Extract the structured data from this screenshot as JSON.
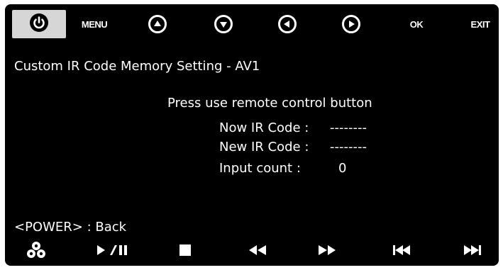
{
  "topbar": {
    "menu_label": "MENU",
    "ok_label": "OK",
    "exit_label": "EXIT"
  },
  "screen": {
    "title": "Custom IR Code Memory Setting - AV1",
    "instruction": "Press use remote control button",
    "now_ir_label": "Now IR Code :",
    "now_ir_value": "--------",
    "new_ir_label": "New IR Code :",
    "new_ir_value": "--------",
    "input_count_label": "Input count :",
    "input_count_value": "0",
    "footer_hint": "<POWER> : Back"
  },
  "icons": {
    "top": [
      "power-icon",
      "up-arrow-icon",
      "down-arrow-icon",
      "left-arrow-icon",
      "right-arrow-icon"
    ],
    "bottom": [
      "color-buttons-icon",
      "play-pause-icon",
      "stop-icon",
      "rewind-icon",
      "fast-forward-icon",
      "previous-track-icon",
      "next-track-icon"
    ]
  },
  "colors": {
    "background": "#000000",
    "text": "#ffffff",
    "power_button_bg": "#d6d6d6"
  }
}
